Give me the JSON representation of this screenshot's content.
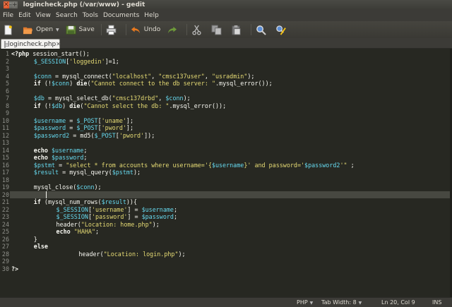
{
  "window": {
    "title": "logincheck.php (/var/www) - gedit"
  },
  "menubar": [
    "File",
    "Edit",
    "View",
    "Search",
    "Tools",
    "Documents",
    "Help"
  ],
  "toolbar": {
    "new_icon": "new-document-icon",
    "open_label": "Open",
    "save_label": "Save",
    "print_icon": "print-icon",
    "undo_label": "Undo",
    "redo_icon": "redo-icon",
    "cut_icon": "cut-icon",
    "copy_icon": "copy-icon",
    "paste_icon": "paste-icon",
    "find_icon": "find-icon",
    "replace_icon": "replace-icon"
  },
  "tab": {
    "label": "logincheck.php",
    "close": "✕"
  },
  "editor": {
    "current_line": 20,
    "lines": [
      [
        [
          "ph",
          "<?php"
        ],
        [
          "f",
          " session_start();"
        ]
      ],
      [
        [
          "f",
          "\t"
        ],
        [
          "v",
          "$_SESSION"
        ],
        [
          "f",
          "["
        ],
        [
          "s",
          "'loggedin'"
        ],
        [
          "f",
          "]=1;"
        ]
      ],
      [],
      [
        [
          "f",
          "\t"
        ],
        [
          "v",
          "$conn"
        ],
        [
          "f",
          " = mysql_connect("
        ],
        [
          "s",
          "\"localhost\""
        ],
        [
          "f",
          ", "
        ],
        [
          "s",
          "\"cmsc137user\""
        ],
        [
          "f",
          ", "
        ],
        [
          "s",
          "\"usradmin\""
        ],
        [
          "f",
          ");"
        ]
      ],
      [
        [
          "f",
          "\t"
        ],
        [
          "k",
          "if"
        ],
        [
          "f",
          " (!"
        ],
        [
          "v",
          "$conn"
        ],
        [
          "f",
          ") "
        ],
        [
          "k",
          "die"
        ],
        [
          "f",
          "("
        ],
        [
          "s",
          "\"Cannot connect to the db server: \""
        ],
        [
          "f",
          ".mysql_error());"
        ]
      ],
      [],
      [
        [
          "f",
          "\t"
        ],
        [
          "v",
          "$db"
        ],
        [
          "f",
          " = mysql_select_db("
        ],
        [
          "s",
          "\"cmsc137drbd\""
        ],
        [
          "f",
          ", "
        ],
        [
          "v",
          "$conn"
        ],
        [
          "f",
          ");"
        ]
      ],
      [
        [
          "f",
          "\t"
        ],
        [
          "k",
          "if"
        ],
        [
          "f",
          " (!"
        ],
        [
          "v",
          "$db"
        ],
        [
          "f",
          ") "
        ],
        [
          "k",
          "die"
        ],
        [
          "f",
          "("
        ],
        [
          "s",
          "\"Cannot select the db: \""
        ],
        [
          "f",
          ".mysql_error());"
        ]
      ],
      [],
      [
        [
          "f",
          "\t"
        ],
        [
          "v",
          "$username"
        ],
        [
          "f",
          " = "
        ],
        [
          "v",
          "$_POST"
        ],
        [
          "f",
          "["
        ],
        [
          "s",
          "'uname'"
        ],
        [
          "f",
          "];"
        ]
      ],
      [
        [
          "f",
          "\t"
        ],
        [
          "v",
          "$password"
        ],
        [
          "f",
          " = "
        ],
        [
          "v",
          "$_POST"
        ],
        [
          "f",
          "["
        ],
        [
          "s",
          "'pword'"
        ],
        [
          "f",
          "];"
        ]
      ],
      [
        [
          "f",
          "\t"
        ],
        [
          "v",
          "$password2"
        ],
        [
          "f",
          " = md5("
        ],
        [
          "v",
          "$_POST"
        ],
        [
          "f",
          "["
        ],
        [
          "s",
          "'pword'"
        ],
        [
          "f",
          "]);"
        ]
      ],
      [],
      [
        [
          "f",
          "\t"
        ],
        [
          "k",
          "echo"
        ],
        [
          "f",
          " "
        ],
        [
          "v",
          "$username"
        ],
        [
          "f",
          ";"
        ]
      ],
      [
        [
          "f",
          "\t"
        ],
        [
          "k",
          "echo"
        ],
        [
          "f",
          " "
        ],
        [
          "v",
          "$password"
        ],
        [
          "f",
          ";"
        ]
      ],
      [
        [
          "f",
          "\t"
        ],
        [
          "v",
          "$pstmt"
        ],
        [
          "f",
          " = "
        ],
        [
          "s",
          "\"select * from accounts where username='{"
        ],
        [
          "v",
          "$username"
        ],
        [
          "s",
          "}' and password='"
        ],
        [
          "v",
          "$password2"
        ],
        [
          "s",
          "'\""
        ],
        [
          "f",
          " ;"
        ]
      ],
      [
        [
          "f",
          "\t"
        ],
        [
          "v",
          "$result"
        ],
        [
          "f",
          " = mysql_query("
        ],
        [
          "v",
          "$pstmt"
        ],
        [
          "f",
          ");"
        ]
      ],
      [],
      [
        [
          "f",
          "\tmysql_close("
        ],
        [
          "v",
          "$conn"
        ],
        [
          "f",
          ");"
        ]
      ],
      [
        [
          "f",
          "\t"
        ]
      ],
      [
        [
          "f",
          "\t"
        ],
        [
          "k",
          "if"
        ],
        [
          "f",
          " (mysql_num_rows("
        ],
        [
          "v",
          "$result"
        ],
        [
          "f",
          ")){"
        ]
      ],
      [
        [
          "f",
          "\t\t"
        ],
        [
          "v",
          "$_SESSION"
        ],
        [
          "f",
          "["
        ],
        [
          "s",
          "'username'"
        ],
        [
          "f",
          "] = "
        ],
        [
          "v",
          "$username"
        ],
        [
          "f",
          ";"
        ]
      ],
      [
        [
          "f",
          "\t\t"
        ],
        [
          "v",
          "$_SESSION"
        ],
        [
          "f",
          "["
        ],
        [
          "s",
          "'password'"
        ],
        [
          "f",
          "] = "
        ],
        [
          "v",
          "$password"
        ],
        [
          "f",
          ";"
        ]
      ],
      [
        [
          "f",
          "\t\theader("
        ],
        [
          "s",
          "\"Location: home.php\""
        ],
        [
          "f",
          ");"
        ]
      ],
      [
        [
          "f",
          "\t\t"
        ],
        [
          "k",
          "echo"
        ],
        [
          "f",
          " "
        ],
        [
          "s",
          "\"HAHA\""
        ],
        [
          "f",
          ";"
        ]
      ],
      [
        [
          "f",
          "\t}"
        ]
      ],
      [
        [
          "f",
          "\t"
        ],
        [
          "k",
          "else"
        ]
      ],
      [
        [
          "f",
          "\t\t\theader("
        ],
        [
          "s",
          "\"Location: login.php\""
        ],
        [
          "f",
          ");"
        ]
      ],
      [],
      [
        [
          "ph",
          "?>"
        ]
      ]
    ]
  },
  "statusbar": {
    "language": "PHP",
    "tab_width": "Tab Width: 8",
    "position": "Ln 20, Col 9",
    "mode": "INS"
  },
  "colors": {
    "editor_bg": "#272822",
    "variable": "#66d9ef",
    "string": "#e6db74",
    "current_line": "#474841"
  }
}
